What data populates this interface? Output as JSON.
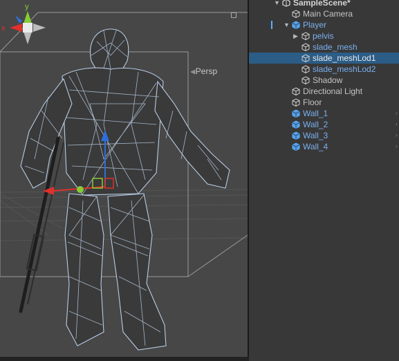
{
  "scene_view": {
    "projection_label": "Persp",
    "gizmo": {
      "x_axis_label": "x",
      "y_axis_label": "y"
    }
  },
  "hierarchy": {
    "scene_name": "SampleScene*",
    "items": [
      {
        "label": "Main Camera",
        "icon": "gameobject-icon",
        "prefab": false,
        "selected": false
      },
      {
        "label": "Player",
        "icon": "prefab-icon",
        "prefab": true,
        "expanded": true,
        "selected": false
      },
      {
        "label": "pelvis",
        "icon": "gameobject-icon",
        "prefab": true,
        "selected": false
      },
      {
        "label": "slade_mesh",
        "icon": "gameobject-icon",
        "prefab": true,
        "selected": false
      },
      {
        "label": "slade_meshLod1",
        "icon": "gameobject-icon",
        "prefab": true,
        "selected": true
      },
      {
        "label": "slade_meshLod2",
        "icon": "gameobject-icon",
        "prefab": true,
        "selected": false
      },
      {
        "label": "Shadow",
        "icon": "gameobject-icon",
        "prefab": false,
        "selected": false
      },
      {
        "label": "Directional Light",
        "icon": "gameobject-icon",
        "prefab": false,
        "selected": false
      },
      {
        "label": "Floor",
        "icon": "gameobject-icon",
        "prefab": false,
        "selected": false
      },
      {
        "label": "Wall_1",
        "icon": "prefab-icon",
        "prefab": true,
        "selected": false
      },
      {
        "label": "Wall_2",
        "icon": "prefab-icon",
        "prefab": true,
        "selected": false
      },
      {
        "label": "Wall_3",
        "icon": "prefab-icon",
        "prefab": true,
        "selected": false
      },
      {
        "label": "Wall_4",
        "icon": "prefab-icon",
        "prefab": true,
        "selected": false
      }
    ]
  },
  "colors": {
    "scene_background": "#474747",
    "wire": "#b8cde6",
    "selection_highlight": "#2c5d87",
    "prefab_text": "#7ab0f0",
    "x_axis": "#e0312a",
    "y_axis": "#86cc35",
    "z_axis": "#2f6fd9"
  }
}
